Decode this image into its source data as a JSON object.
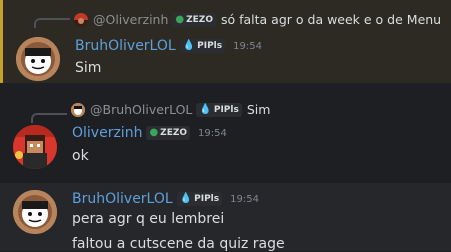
{
  "messages": [
    {
      "reply": {
        "mention": "@Oliverzinh",
        "tag": "ZEZO",
        "text": "só falta agr o da week e o de Menu"
      },
      "author": "BruhOliverLOL",
      "tag": "PIPls",
      "time": "19:54",
      "lines": [
        "Sim"
      ]
    },
    {
      "reply": {
        "mention": "@BruhOliverLOL",
        "tag": "PIPls",
        "text": "Sim"
      },
      "author": "Oliverzinh",
      "tag": "ZEZO",
      "time": "19:54",
      "lines": [
        "ok"
      ]
    },
    {
      "author": "BruhOliverLOL",
      "tag": "PIPls",
      "time": "19:54",
      "lines": [
        "pera agr q eu lembrei",
        "faltou a cutscene da quiz rage"
      ]
    }
  ],
  "colors": {
    "username": "#5da0dc",
    "highlight_bar": "#c4a227",
    "zezo_icon": "#3ba55c",
    "pipls_icon": "#6fb3e0"
  },
  "icons": {
    "zezo": "frog-icon",
    "pipls": "droplet-icon"
  }
}
